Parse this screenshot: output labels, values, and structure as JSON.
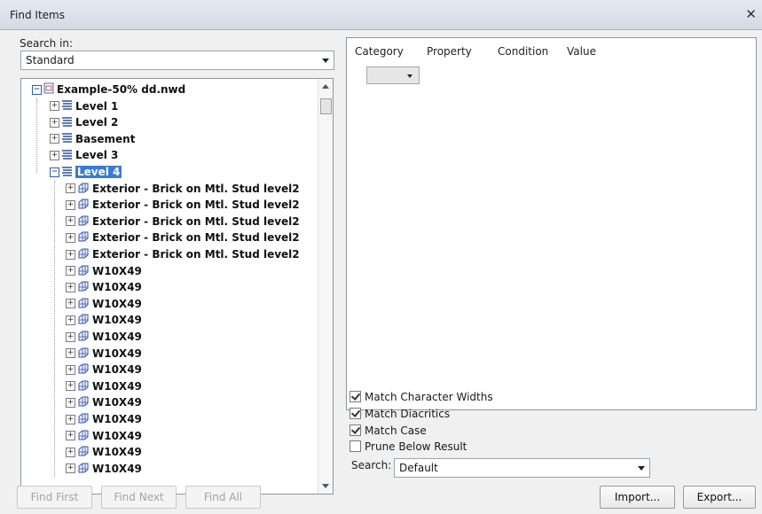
{
  "window": {
    "title": "Find Items"
  },
  "search_in": {
    "label": "Search in:",
    "value": "Standard"
  },
  "tree": {
    "root": "Example-50% dd.nwd",
    "levels": [
      "Level 1",
      "Level 2",
      "Basement",
      "Level 3"
    ],
    "selected_level": "Level 4",
    "children": [
      "Exterior - Brick on Mtl. Stud level2",
      "Exterior - Brick on Mtl. Stud level2",
      "Exterior - Brick on Mtl. Stud level2",
      "Exterior - Brick on Mtl. Stud level2",
      "Exterior - Brick on Mtl. Stud level2",
      "W10X49",
      "W10X49",
      "W10X49",
      "W10X49",
      "W10X49",
      "W10X49",
      "W10X49",
      "W10X49",
      "W10X49",
      "W10X49",
      "W10X49",
      "W10X49",
      "W10X49"
    ]
  },
  "conditions_grid": {
    "columns": [
      "Category",
      "Property",
      "Condition",
      "Value"
    ]
  },
  "options": [
    {
      "label": "Match Character Widths",
      "checked": true
    },
    {
      "label": "Match Diacritics",
      "checked": true
    },
    {
      "label": "Match Case",
      "checked": true
    },
    {
      "label": "Prune Below Result",
      "checked": false
    }
  ],
  "search": {
    "label": "Search:",
    "value": "Default"
  },
  "buttons": {
    "find_first": "Find First",
    "find_next": "Find Next",
    "find_all": "Find All",
    "import": "Import...",
    "export": "Export..."
  }
}
